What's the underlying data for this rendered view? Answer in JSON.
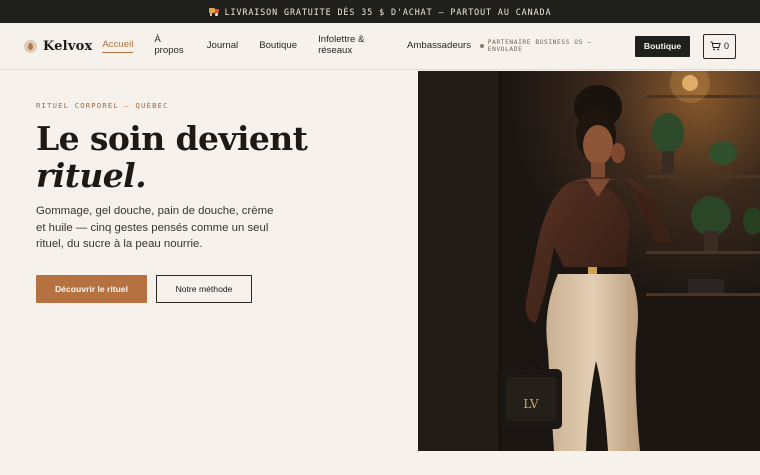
{
  "announcement": {
    "text": "LIVRAISON GRATUITE DÈS 35 $ D'ACHAT — PARTOUT AU CANADA",
    "icon": "truck-icon"
  },
  "header": {
    "brand": "Kelvox",
    "nav": [
      {
        "label": "Accueil",
        "active": true
      },
      {
        "label": "À propos",
        "active": false
      },
      {
        "label": "Journal",
        "active": false
      },
      {
        "label": "Boutique",
        "active": false
      },
      {
        "label": "Infolettre & réseaux",
        "active": false
      },
      {
        "label": "Ambassadeurs",
        "active": false
      }
    ],
    "partner": "PARTENAIRE BUSINESS OS — ENVOLADE",
    "shop_button": "Boutique",
    "cart_count": "0"
  },
  "hero": {
    "eyebrow": "RITUEL CORPOREL — QUÉBEC",
    "title_line1": "Le soin devient",
    "title_line2": "rituel.",
    "body": "Gommage, gel douche, pain de douche, crème et huile — cinq gestes pensés comme un seul rituel, du sucre à la peau nourrie.",
    "primary_button": "Découvrir le rituel",
    "secondary_button": "Notre méthode",
    "image_alt": "woman-in-brown-blouse-with-handbag-photo"
  },
  "colors": {
    "accent": "#b5713f",
    "dark": "#1f201b",
    "background": "#f6f1ea"
  }
}
